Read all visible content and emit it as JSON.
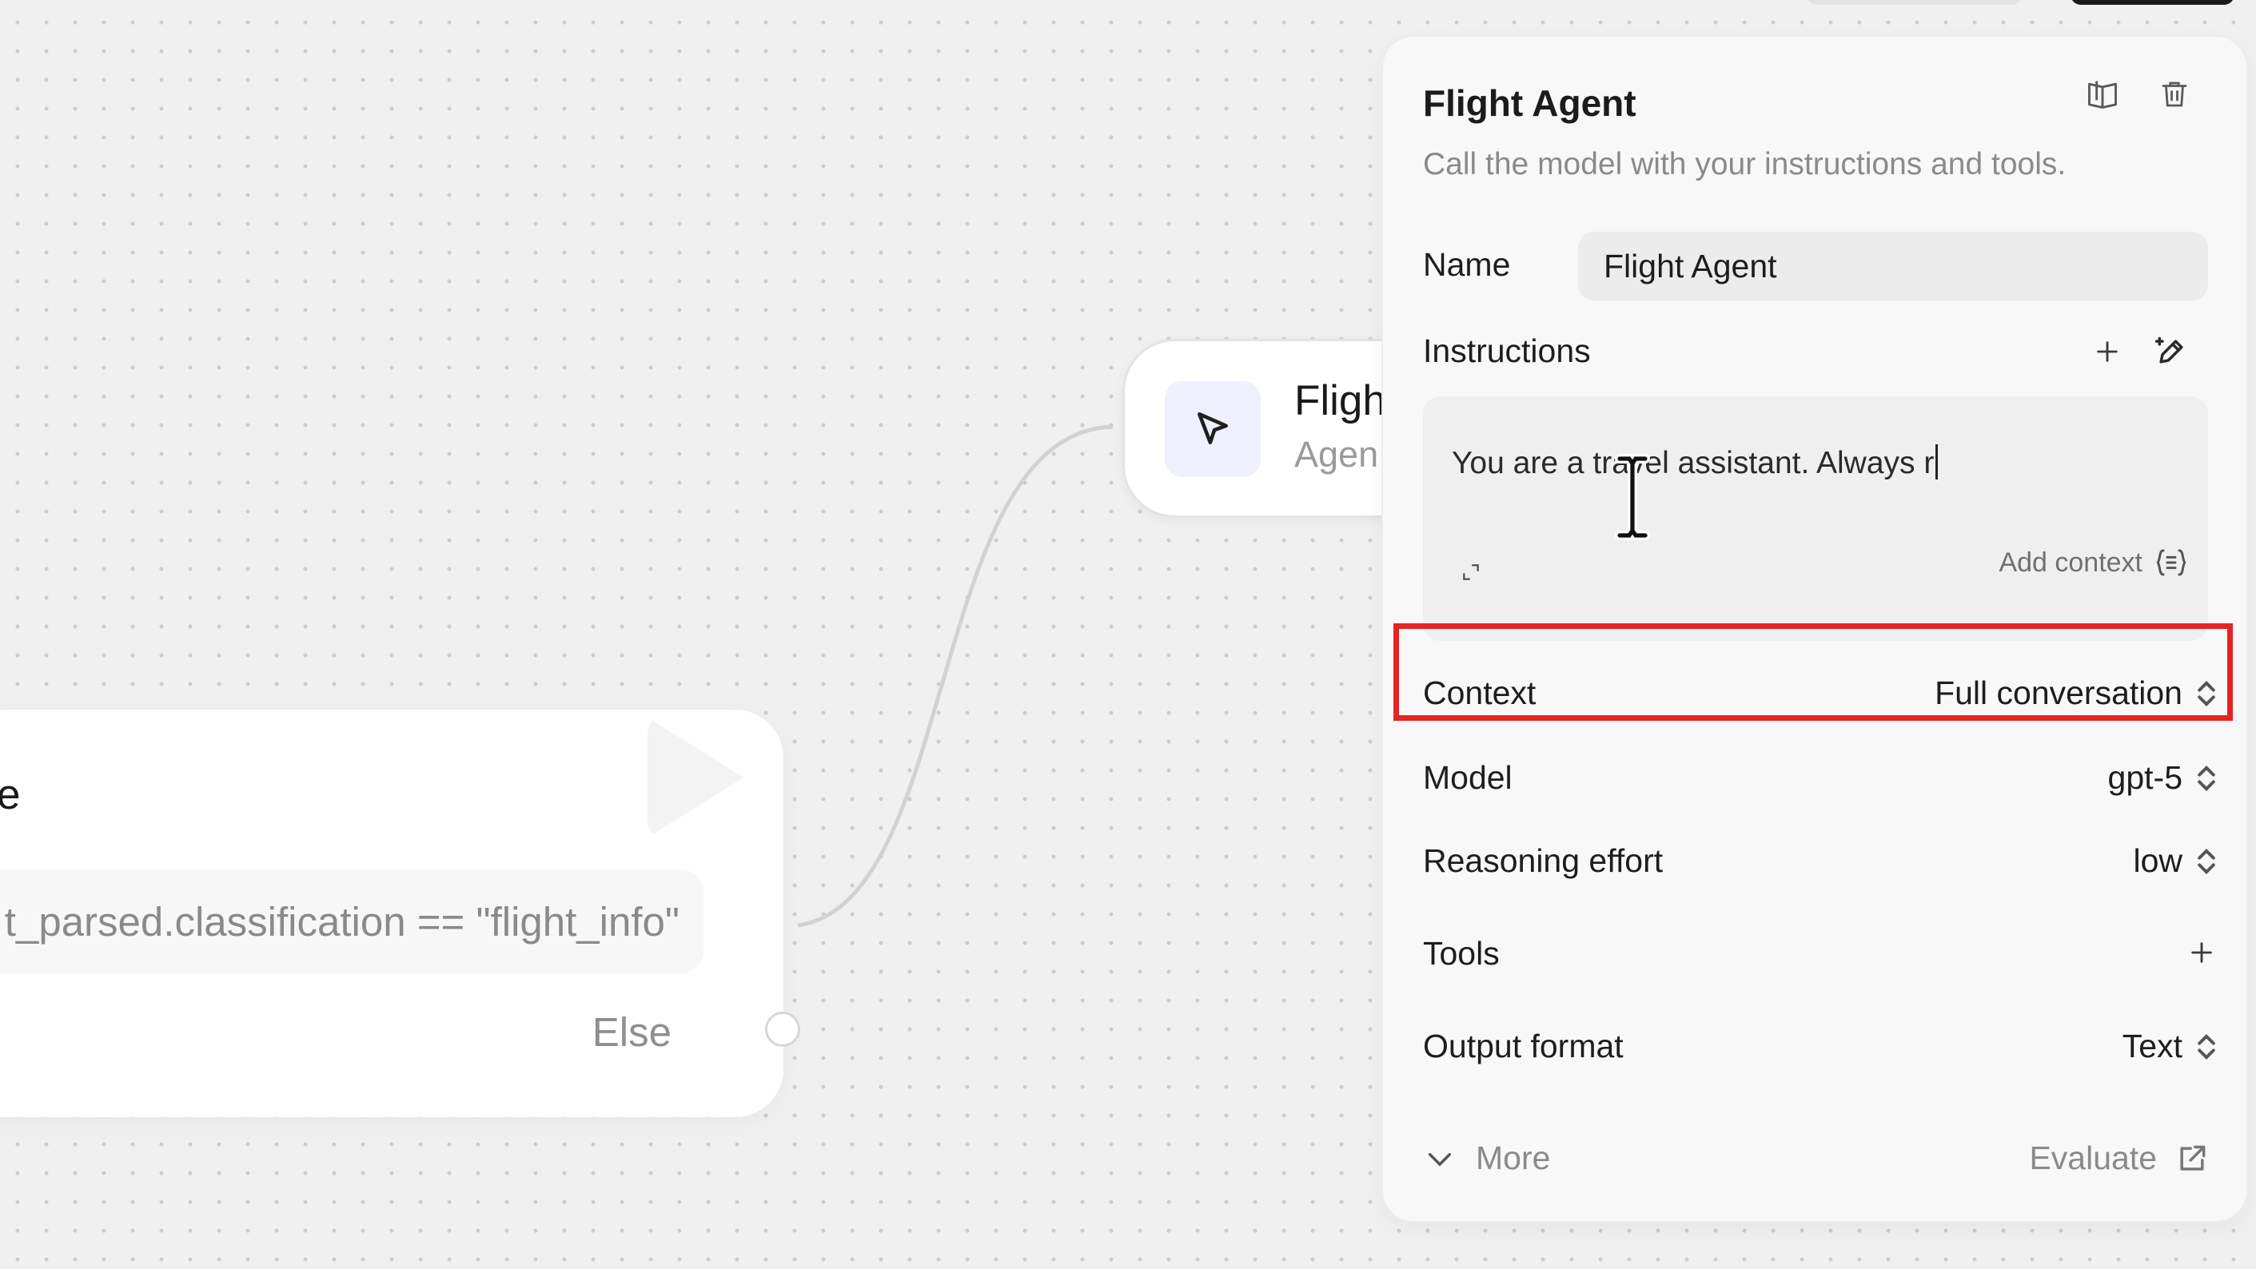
{
  "canvas": {
    "agent_node": {
      "title": "Fligh",
      "subtitle": "Agen",
      "icon": "agent-cursor-icon"
    },
    "ifelse_node": {
      "title_fragment": "e",
      "condition": "t_parsed.classification == \"flight_info\"",
      "else_label": "Else"
    }
  },
  "panel": {
    "title": "Flight Agent",
    "description": "Call the model with your instructions and tools.",
    "header_icons": [
      "book-icon",
      "trash-icon"
    ],
    "name": {
      "label": "Name",
      "value": "Flight Agent"
    },
    "instructions": {
      "label": "Instructions",
      "text": "You are a travel assistant. Always r",
      "add_context_label": "Add context",
      "icons": [
        "plus-icon",
        "magic-edit-icon",
        "expand-icon",
        "variable-braces-icon"
      ]
    },
    "context": {
      "label": "Context",
      "value": "Full conversation"
    },
    "model": {
      "label": "Model",
      "value": "gpt-5"
    },
    "reasoning_effort": {
      "label": "Reasoning effort",
      "value": "low"
    },
    "tools": {
      "label": "Tools"
    },
    "output_format": {
      "label": "Output format",
      "value": "Text"
    },
    "more_label": "More",
    "evaluate_label": "Evaluate"
  },
  "colors": {
    "highlight": "#e52423",
    "canvas_bg": "#f0f0f0",
    "node_icon_bg": "#eef0fd"
  }
}
